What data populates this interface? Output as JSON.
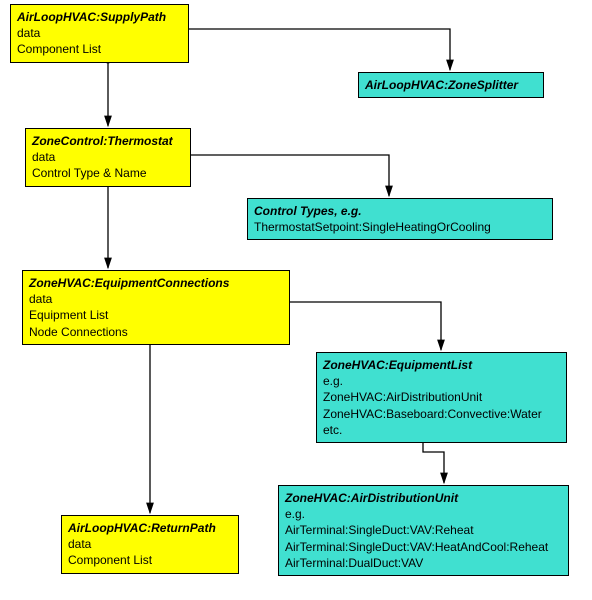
{
  "boxes": {
    "supplyPath": {
      "title": "AirLoopHVAC:SupplyPath",
      "line1": "data",
      "line2": "Component List"
    },
    "zoneSplitter": {
      "title": "AirLoopHVAC:ZoneSplitter"
    },
    "thermostat": {
      "title": "ZoneControl:Thermostat",
      "line1": "data",
      "line2": "Control Type & Name"
    },
    "controlTypes": {
      "title": "Control Types, e.g.",
      "line1": "ThermostatSetpoint:SingleHeatingOrCooling"
    },
    "equipConn": {
      "title": "ZoneHVAC:EquipmentConnections",
      "line1": "data",
      "line2": "Equipment List",
      "line3": "Node Connections"
    },
    "equipList": {
      "title": "ZoneHVAC:EquipmentList",
      "line1": "e.g.",
      "line2": "ZoneHVAC:AirDistributionUnit",
      "line3": "ZoneHVAC:Baseboard:Convective:Water",
      "line4": "etc."
    },
    "airDist": {
      "title": "ZoneHVAC:AirDistributionUnit",
      "line1": "e.g.",
      "line2": "AirTerminal:SingleDuct:VAV:Reheat",
      "line3": "AirTerminal:SingleDuct:VAV:HeatAndCool:Reheat",
      "line4": "AirTerminal:DualDuct:VAV"
    },
    "returnPath": {
      "title": "AirLoopHVAC:ReturnPath",
      "line1": "data",
      "line2": "Component List"
    }
  },
  "colors": {
    "yellow": "#ffff00",
    "cyan": "#40e0d0"
  }
}
